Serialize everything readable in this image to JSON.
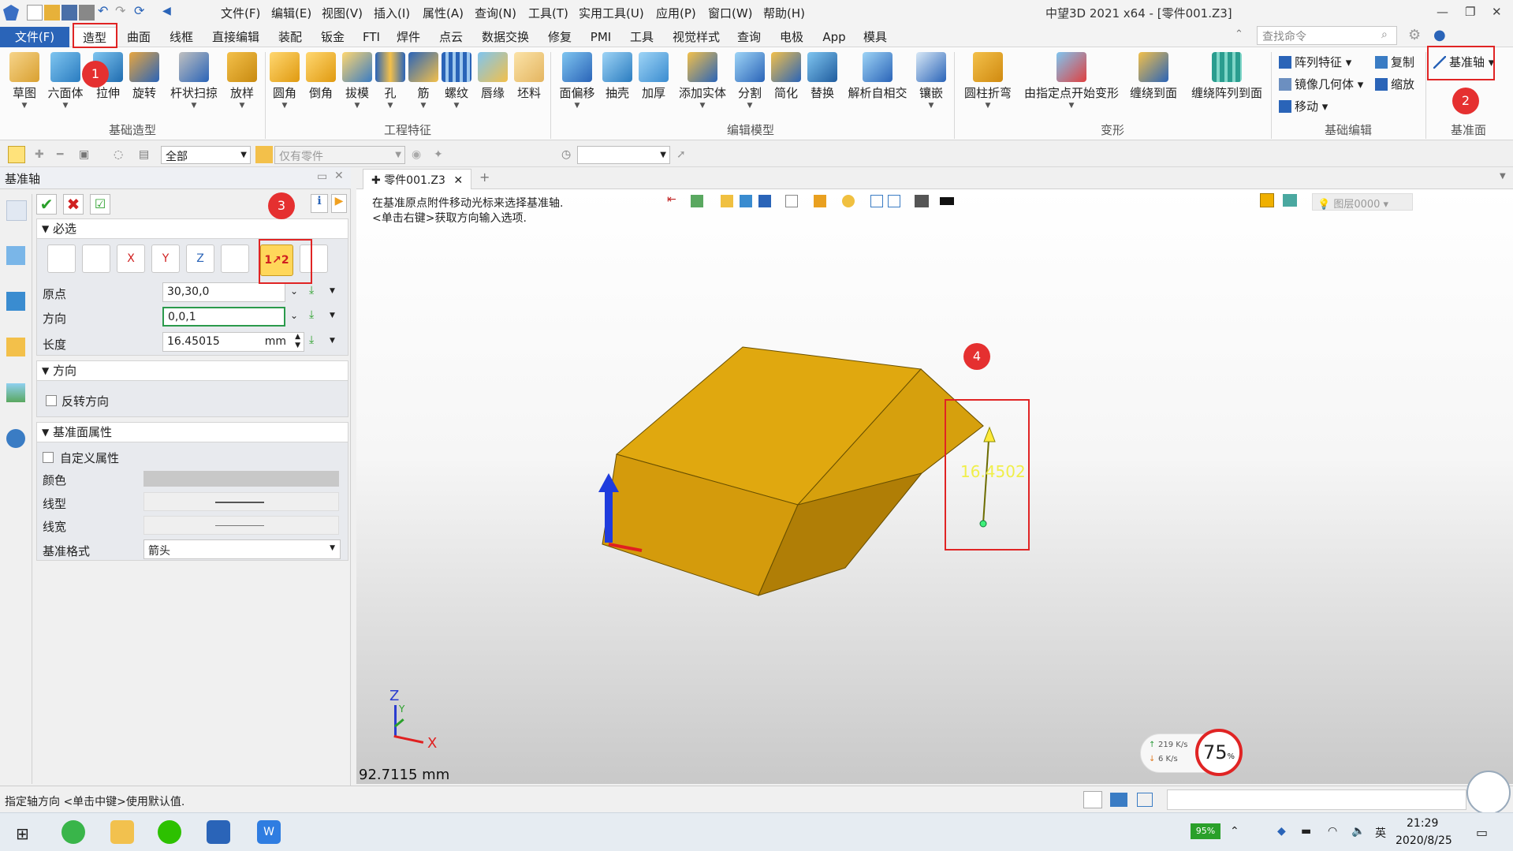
{
  "app": {
    "title": "中望3D 2021 x64 - [零件001.Z3]",
    "menu": [
      "文件(F)",
      "编辑(E)",
      "视图(V)",
      "插入(I)",
      "属性(A)",
      "查询(N)",
      "工具(T)",
      "实用工具(U)",
      "应用(P)",
      "窗口(W)",
      "帮助(H)"
    ]
  },
  "tabs": [
    "文件(F)",
    "造型",
    "曲面",
    "线框",
    "直接编辑",
    "装配",
    "钣金",
    "FTI",
    "焊件",
    "点云",
    "数据交换",
    "修复",
    "PMI",
    "工具",
    "视觉样式",
    "查询",
    "电极",
    "App",
    "模具"
  ],
  "search": {
    "placeholder": "查找命令"
  },
  "ribbon": {
    "basic_modeling": {
      "label": "基础造型",
      "buttons": [
        "草图",
        "六面体",
        "拉伸",
        "旋转",
        "杆状扫掠",
        "放样"
      ]
    },
    "engineering": {
      "label": "工程特征",
      "buttons": [
        "圆角",
        "倒角",
        "拔模",
        "孔",
        "筋",
        "螺纹",
        "唇缘",
        "坯料"
      ]
    },
    "edit_model": {
      "label": "编辑模型",
      "buttons": [
        "面偏移",
        "抽壳",
        "加厚",
        "添加实体",
        "分割",
        "简化",
        "替换",
        "解析自相交",
        "镶嵌"
      ]
    },
    "deform": {
      "label": "变形",
      "buttons": [
        "圆柱折弯",
        "由指定点开始变形",
        "缠绕到面",
        "缠绕阵列到面"
      ]
    },
    "basic_edit": {
      "label": "基础编辑",
      "items": [
        "阵列特征",
        "复制",
        "镜像几何体",
        "缩放",
        "移动"
      ]
    },
    "datum": {
      "label": "基准面",
      "button": "基准轴"
    }
  },
  "toolbar2": {
    "filter": "全部",
    "scope": "仅有零件"
  },
  "panel": {
    "title": "基准轴",
    "required_section": "必选",
    "origin_label": "原点",
    "origin_value": "30,30,0",
    "direction_label": "方向",
    "direction_value": "0,0,1",
    "length_label": "长度",
    "length_value": "16.45015",
    "length_unit": "mm",
    "direction_section": "方向",
    "reverse_label": "反转方向",
    "props_section": "基准面属性",
    "custom_label": "自定义属性",
    "color_label": "颜色",
    "linetype_label": "线型",
    "linewidth_label": "线宽",
    "style_label": "基准格式",
    "style_value": "箭头"
  },
  "document_tab": "零件001.Z3",
  "viewport": {
    "hint_line1": "在基准原点附件移动光标来选择基准轴.",
    "hint_line2": "<单击右键>获取方向输入选项.",
    "layer": "图层0000",
    "axis_length_label": "16.4502",
    "measure": "92.7115 mm",
    "triad": {
      "z": "Z",
      "x": "X",
      "y": "Y"
    }
  },
  "net_widget": {
    "up": "219 K/s",
    "down": "6  K/s",
    "percent": "75",
    "pct_sign": "%"
  },
  "status": {
    "text": "指定轴方向 <单击中键>使用默认值."
  },
  "annotations": [
    "1",
    "2",
    "3",
    "4"
  ],
  "taskbar": {
    "battery": "95%",
    "time": "21:29",
    "date": "2020/8/25"
  },
  "colors": {
    "accent": "#2a64b8",
    "annotation": "#e02424",
    "part": "#d9a10a",
    "highlight": "#2b9a4c"
  }
}
